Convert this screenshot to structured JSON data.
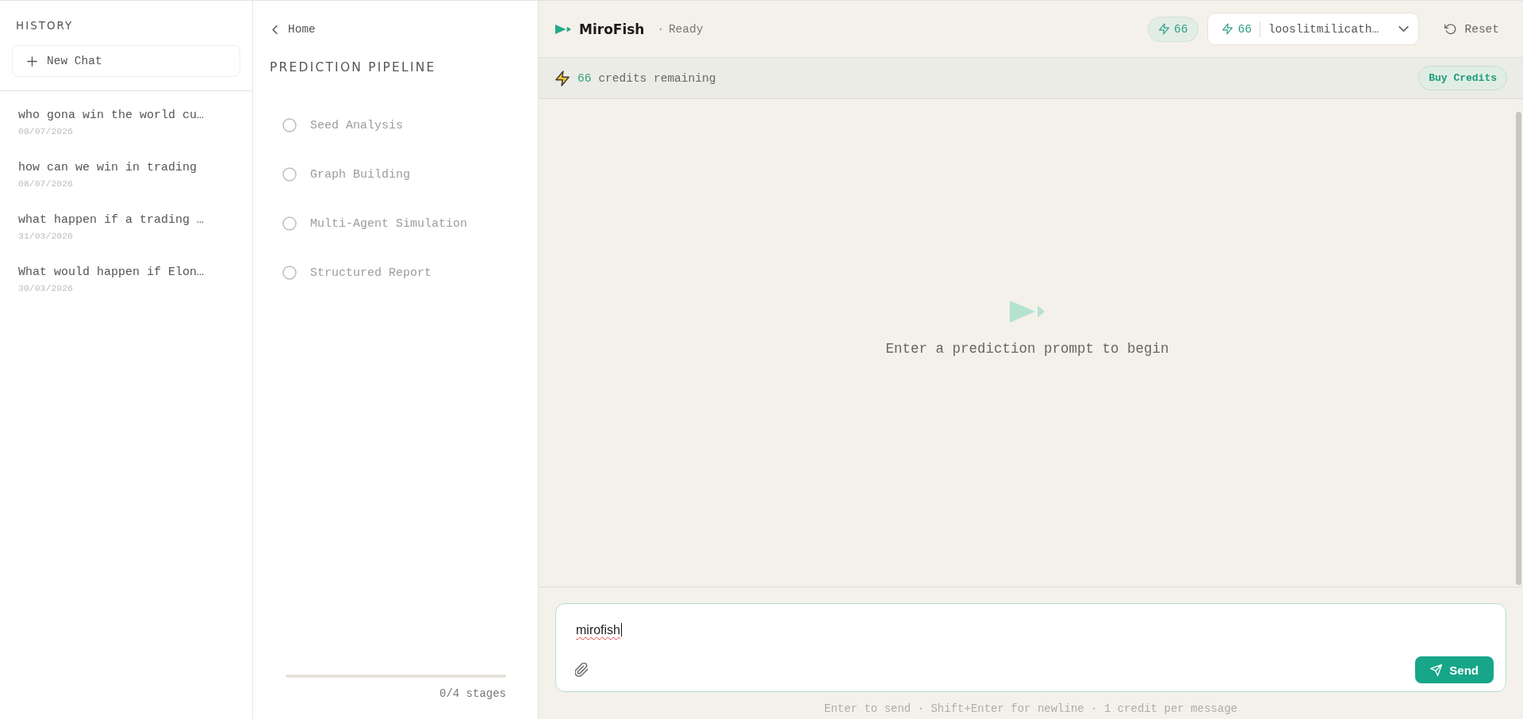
{
  "sidebar": {
    "heading": "HISTORY",
    "new_chat": "New Chat",
    "items": [
      {
        "title": "who gona win the world cu…",
        "date": "08/07/2026",
        "selected": false
      },
      {
        "title": "how can we win in trading",
        "date": "08/07/2026",
        "selected": false
      },
      {
        "title": "what happen if a trading …",
        "date": "31/03/2026",
        "selected": false
      },
      {
        "title": "What would happen if Elon…",
        "date": "30/03/2026",
        "selected": false
      }
    ]
  },
  "pipeline": {
    "back": "Home",
    "title": "PREDICTION PIPELINE",
    "stages": [
      {
        "label": "Seed Analysis",
        "done": false
      },
      {
        "label": "Graph Building",
        "done": false
      },
      {
        "label": "Multi-Agent Simulation",
        "done": false
      },
      {
        "label": "Structured Report",
        "done": false
      }
    ],
    "progress": {
      "level": 0,
      "label": "0/4 stages"
    }
  },
  "header": {
    "app_name": "MiroFish",
    "separator": "·",
    "status": "Ready",
    "credits_badge": "66",
    "account": {
      "credits": "66",
      "name": "looslitmilicath…"
    },
    "reset": "Reset"
  },
  "credits_bar": {
    "count": "66",
    "label": "credits remaining",
    "buy_button": "Buy Credits"
  },
  "empty_state": {
    "message": "Enter a prediction prompt to begin"
  },
  "composer": {
    "value": "mirofish",
    "send": "Send",
    "hint": "Enter to send · Shift+Enter for newline · 1 credit per message"
  }
}
